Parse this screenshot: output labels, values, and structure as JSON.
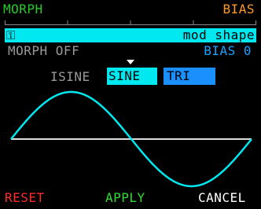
{
  "header": {
    "left_label": "MORPH",
    "right_label": "BIAS",
    "left_color": "#22cc22",
    "right_color": "#ff9a22"
  },
  "param_bar": {
    "icon": "key-icon",
    "icon_glyph": "⚿",
    "name": "mod shape",
    "color": "#00e8f0"
  },
  "values": {
    "morph": "MORPH OFF",
    "bias": "BIAS 0"
  },
  "shape_options": {
    "items": [
      {
        "label": "ISINE",
        "state": "normal"
      },
      {
        "label": "SINE",
        "state": "selected"
      },
      {
        "label": "TRI",
        "state": "highlight"
      }
    ]
  },
  "waveform": {
    "type": "sine",
    "cycles": 1,
    "color": "#00e8f0",
    "baseline_color": "#dddddd"
  },
  "footer": {
    "reset": "RESET",
    "apply": "APPLY",
    "cancel": "CANCEL",
    "reset_color": "#ff2a2a",
    "apply_color": "#33dd33",
    "cancel_color": "#ffffff"
  }
}
